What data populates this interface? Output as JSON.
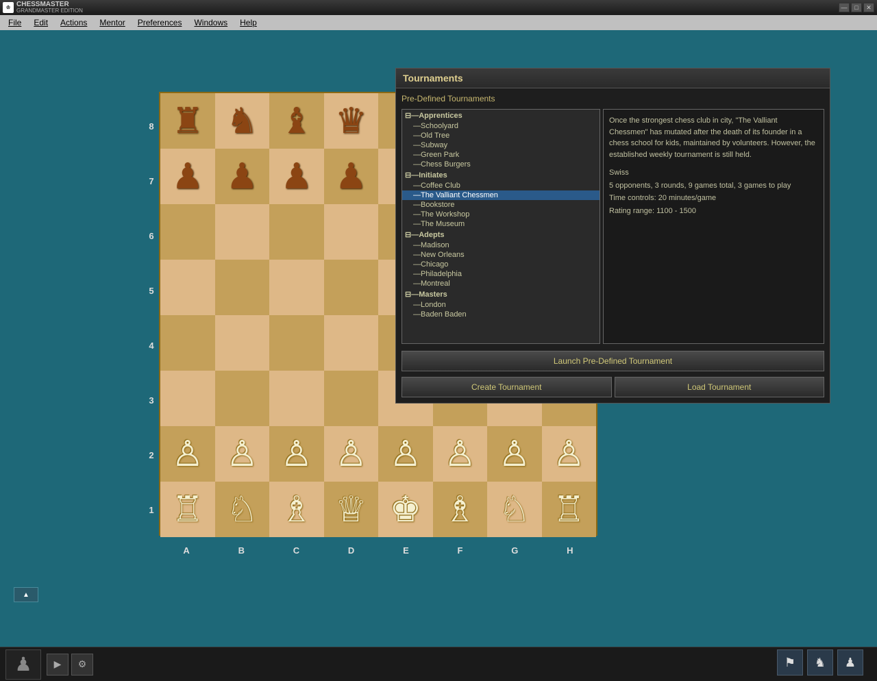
{
  "titlebar": {
    "app_name": "CHESSMASTER",
    "app_subtitle": "GRANDMASTER EDITION",
    "minimize": "—",
    "maximize": "□",
    "close": "✕"
  },
  "menubar": {
    "items": [
      "File",
      "Edit",
      "Actions",
      "Mentor",
      "Preferences",
      "Windows",
      "Help"
    ]
  },
  "tournament": {
    "title": "Tournaments",
    "section_label": "Pre-Defined Tournaments",
    "tree": {
      "apprentices_group": "⊟—Apprentices",
      "schoolyard": "—Schoolyard",
      "old_tree": "—Old Tree",
      "subway": "—Subway",
      "green_park": "—Green Park",
      "chess_burgers": "—Chess Burgers",
      "initiates_group": "⊟—Initiates",
      "coffee_club": "—Coffee Club",
      "valiant_chessmen": "—The Valliant Chessmen",
      "bookstore": "—Bookstore",
      "workshop": "—The Workshop",
      "museum": "—The Museum",
      "adepts_group": "⊟—Adepts",
      "madison": "—Madison",
      "new_orleans": "—New Orleans",
      "chicago": "—Chicago",
      "philadelphia": "—Philadelphia",
      "montreal": "—Montreal",
      "masters_group": "⊟—Masters",
      "london": "—London",
      "baden_baden": "—Baden Baden"
    },
    "info_text_1": "Once the strongest chess club in city, \"The Valliant Chessmen\" has mutated after the death of its founder in a chess school for kids, maintained by volunteers. However, the established weekly tournament is still held.",
    "info_text_2": "Swiss",
    "info_text_3": "5 opponents, 3 rounds, 9 games total, 3 games to play",
    "info_text_4": "Time controls: 20 minutes/game",
    "info_text_5": "Rating range: 1100 - 1500",
    "launch_btn": "Launch Pre-Defined Tournament",
    "create_btn": "Create Tournament",
    "load_btn": "Load Tournament"
  },
  "board": {
    "ranks": [
      "8",
      "7",
      "6",
      "5",
      "4",
      "3",
      "2",
      "1"
    ],
    "files": [
      "A",
      "B",
      "C",
      "D",
      "E",
      "F",
      "G",
      "H"
    ]
  },
  "statusbar": {
    "scroll_up": "▲"
  }
}
